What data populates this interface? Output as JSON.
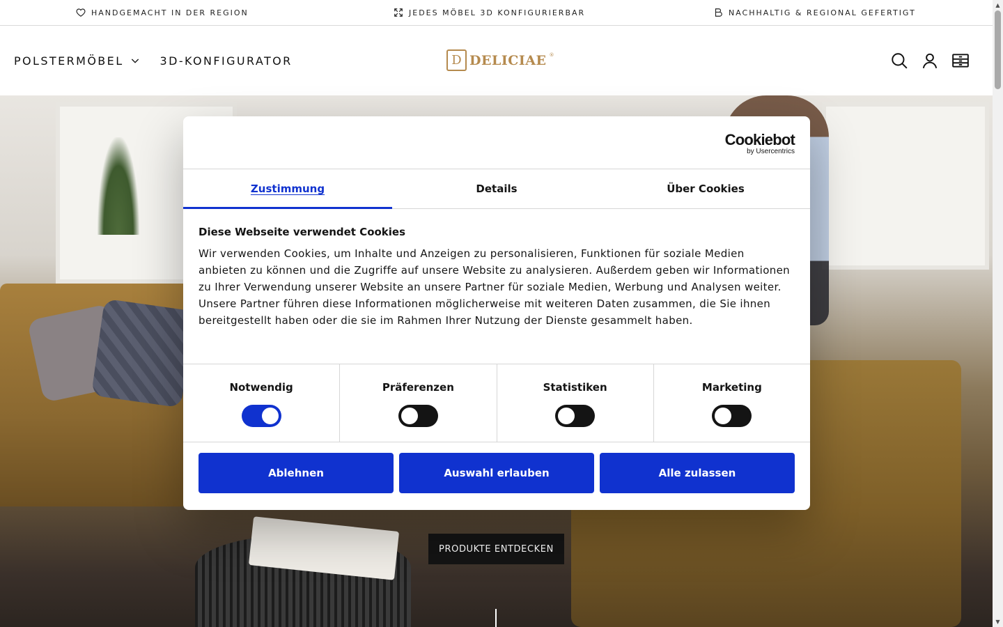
{
  "topbar": {
    "usps": [
      {
        "icon": "heart-icon",
        "text": "HANDGEMACHT IN DER REGION"
      },
      {
        "icon": "expand-icon",
        "text": "JEDES MÖBEL 3D KONFIGURIERBAR"
      },
      {
        "icon": "leaf-icon",
        "text": "NACHHALTIG & REGIONAL GEFERTIGT"
      }
    ]
  },
  "header": {
    "nav": [
      {
        "label": "POLSTERMÖBEL",
        "has_dropdown": true
      },
      {
        "label": "3D-KONFIGURATOR",
        "has_dropdown": false
      }
    ],
    "logo": {
      "mark": "D",
      "text": "DELICIAE",
      "reg": "®",
      "color": "#b58a4e"
    },
    "icons": [
      "search-icon",
      "account-icon",
      "cart-icon"
    ]
  },
  "hero": {
    "cta_label": "PRODUKTE ENTDECKEN"
  },
  "cookie_dialog": {
    "brand": {
      "name": "Cookiebot",
      "sub": "by Usercentrics"
    },
    "tabs": [
      {
        "label": "Zustimmung",
        "active": true
      },
      {
        "label": "Details",
        "active": false
      },
      {
        "label": "Über Cookies",
        "active": false
      }
    ],
    "title": "Diese Webseite verwendet Cookies",
    "text": "Wir verwenden Cookies, um Inhalte und Anzeigen zu personalisieren, Funktionen für soziale Medien anbieten zu können und die Zugriffe auf unsere Website zu analysieren. Außerdem geben wir Informationen zu Ihrer Verwendung unserer Website an unsere Partner für soziale Medien, Werbung und Analysen weiter. Unsere Partner führen diese Informationen möglicherweise mit weiteren Daten zusammen, die Sie ihnen bereitgestellt haben oder die sie im Rahmen Ihrer Nutzung der Dienste gesammelt haben.",
    "toggles": [
      {
        "label": "Notwendig",
        "on": true
      },
      {
        "label": "Präferenzen",
        "on": false
      },
      {
        "label": "Statistiken",
        "on": false
      },
      {
        "label": "Marketing",
        "on": false
      }
    ],
    "buttons": {
      "decline": "Ablehnen",
      "allow_selection": "Auswahl erlauben",
      "allow_all": "Alle zulassen"
    },
    "accent_color": "#1032cf"
  }
}
